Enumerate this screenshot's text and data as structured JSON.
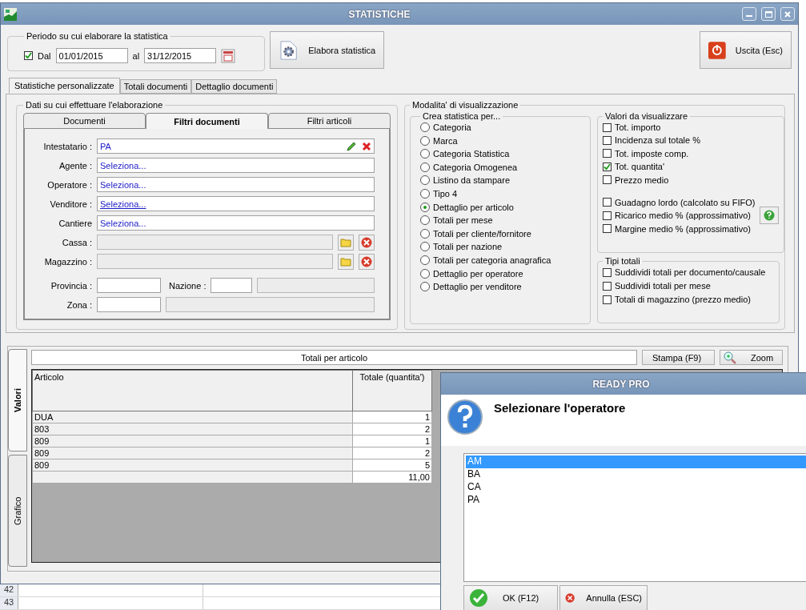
{
  "window": {
    "title": "STATISTICHE"
  },
  "period": {
    "legend": "Periodo su cui elaborare la statistica",
    "from_label": "Dal",
    "from_checked": true,
    "from": "01/01/2015",
    "to_label": "al",
    "to": "31/12/2015"
  },
  "actions": [
    {
      "label": "Elabora statistica",
      "kind": "gear"
    },
    {
      "label": "Uscita (Esc)",
      "kind": "power"
    }
  ],
  "tabs": [
    {
      "label": "Statistiche personalizzate",
      "selected": true
    },
    {
      "label": "Totali documenti",
      "selected": false
    },
    {
      "label": "Dettaglio documenti",
      "selected": false
    }
  ],
  "data_group": {
    "legend": "Dati su cui effettuare l'elaborazione",
    "tabs": [
      {
        "label": "Documenti",
        "selected": false
      },
      {
        "label": "Filtri documenti",
        "selected": true
      },
      {
        "label": "Filtri articoli",
        "selected": false
      }
    ],
    "fields": [
      {
        "label": "Intestatario :",
        "value": "PA",
        "kind": "edit",
        "underlined": false
      },
      {
        "label": "Agente :",
        "value": "Seleziona...",
        "kind": "link",
        "underlined": false
      },
      {
        "label": "Operatore :",
        "value": "Seleziona...",
        "kind": "link",
        "underlined": false
      },
      {
        "label": "Venditore :",
        "value": "Seleziona...",
        "kind": "link",
        "underlined": true
      },
      {
        "label": "Cantiere",
        "value": "Seleziona...",
        "kind": "link",
        "underlined": false
      },
      {
        "label": "Cassa :",
        "kind": "folder"
      },
      {
        "label": "Magazzino :",
        "kind": "folder"
      }
    ],
    "provincia_label": "Provincia :",
    "nazione_label": "Nazione :",
    "zona_label": "Zona :"
  },
  "view_group": {
    "legend": "Modalita' di visualizzazione",
    "create_by": {
      "legend": "Crea statistica per...",
      "options": [
        {
          "label": "Categoria",
          "selected": false
        },
        {
          "label": "Marca",
          "selected": false
        },
        {
          "label": "Categoria Statistica",
          "selected": false
        },
        {
          "label": "Categoria Omogenea",
          "selected": false
        },
        {
          "label": "Listino da stampare",
          "selected": false
        },
        {
          "label": "Tipo 4",
          "selected": false
        },
        {
          "label": "Dettaglio per articolo",
          "selected": true
        },
        {
          "label": "Totali per mese",
          "selected": false
        },
        {
          "label": "Totali per cliente/fornitore",
          "selected": false
        },
        {
          "label": "Totali per nazione",
          "selected": false
        },
        {
          "label": "Totali per categoria anagrafica",
          "selected": false
        },
        {
          "label": "Dettaglio per operatore",
          "selected": false
        },
        {
          "label": "Dettaglio per venditore",
          "selected": false
        }
      ]
    },
    "values": {
      "legend": "Valori da visualizzare",
      "items": [
        {
          "label": "Tot. importo",
          "checked": false
        },
        {
          "label": "Incidenza sul totale %",
          "checked": false
        },
        {
          "label": "Tot. imposte comp.",
          "checked": false
        },
        {
          "label": "Tot. quantita'",
          "checked": true
        },
        {
          "label": "Prezzo medio",
          "checked": false
        }
      ],
      "margin_items": [
        {
          "label": "Guadagno lordo (calcolato su FIFO)",
          "checked": false
        },
        {
          "label": "Ricarico medio % (approssimativo)",
          "checked": false
        },
        {
          "label": "Margine medio % (approssimativo)",
          "checked": false
        }
      ]
    },
    "totals": {
      "legend": "Tipi totali",
      "items": [
        {
          "label": "Suddividi totali per documento/causale",
          "checked": false
        },
        {
          "label": "Suddividi totali per mese",
          "checked": false
        },
        {
          "label": "Totali di magazzino (prezzo medio)",
          "checked": false
        }
      ]
    }
  },
  "results": {
    "side_tabs": [
      {
        "label": "Valori",
        "selected": true
      },
      {
        "label": "Grafico",
        "selected": false
      }
    ],
    "title": "Totali per articolo",
    "buttons": [
      {
        "label": "Stampa (F9)",
        "kind": "plain"
      },
      {
        "label": "Zoom",
        "kind": "zoom"
      }
    ],
    "columns": [
      "Articolo",
      "Totale (quantita')"
    ],
    "rows": [
      {
        "articolo": "DUA",
        "totale": "1"
      },
      {
        "articolo": "803",
        "totale": "2"
      },
      {
        "articolo": "809",
        "totale": "1"
      },
      {
        "articolo": "809",
        "totale": "2"
      },
      {
        "articolo": "809",
        "totale": "5"
      }
    ],
    "total": "11,00"
  },
  "spreadsheet": {
    "row_numbers": [
      "42",
      "43"
    ]
  },
  "dialog": {
    "title": "READY PRO",
    "prompt": "Selezionare l'operatore",
    "options": [
      {
        "label": "AM",
        "selected": true
      },
      {
        "label": "BA",
        "selected": false
      },
      {
        "label": "CA",
        "selected": false
      },
      {
        "label": "PA",
        "selected": false
      }
    ],
    "buttons": [
      {
        "label": "OK (F12)",
        "kind": "ok"
      },
      {
        "label": "Annulla (ESC)",
        "kind": "cancel"
      }
    ]
  }
}
